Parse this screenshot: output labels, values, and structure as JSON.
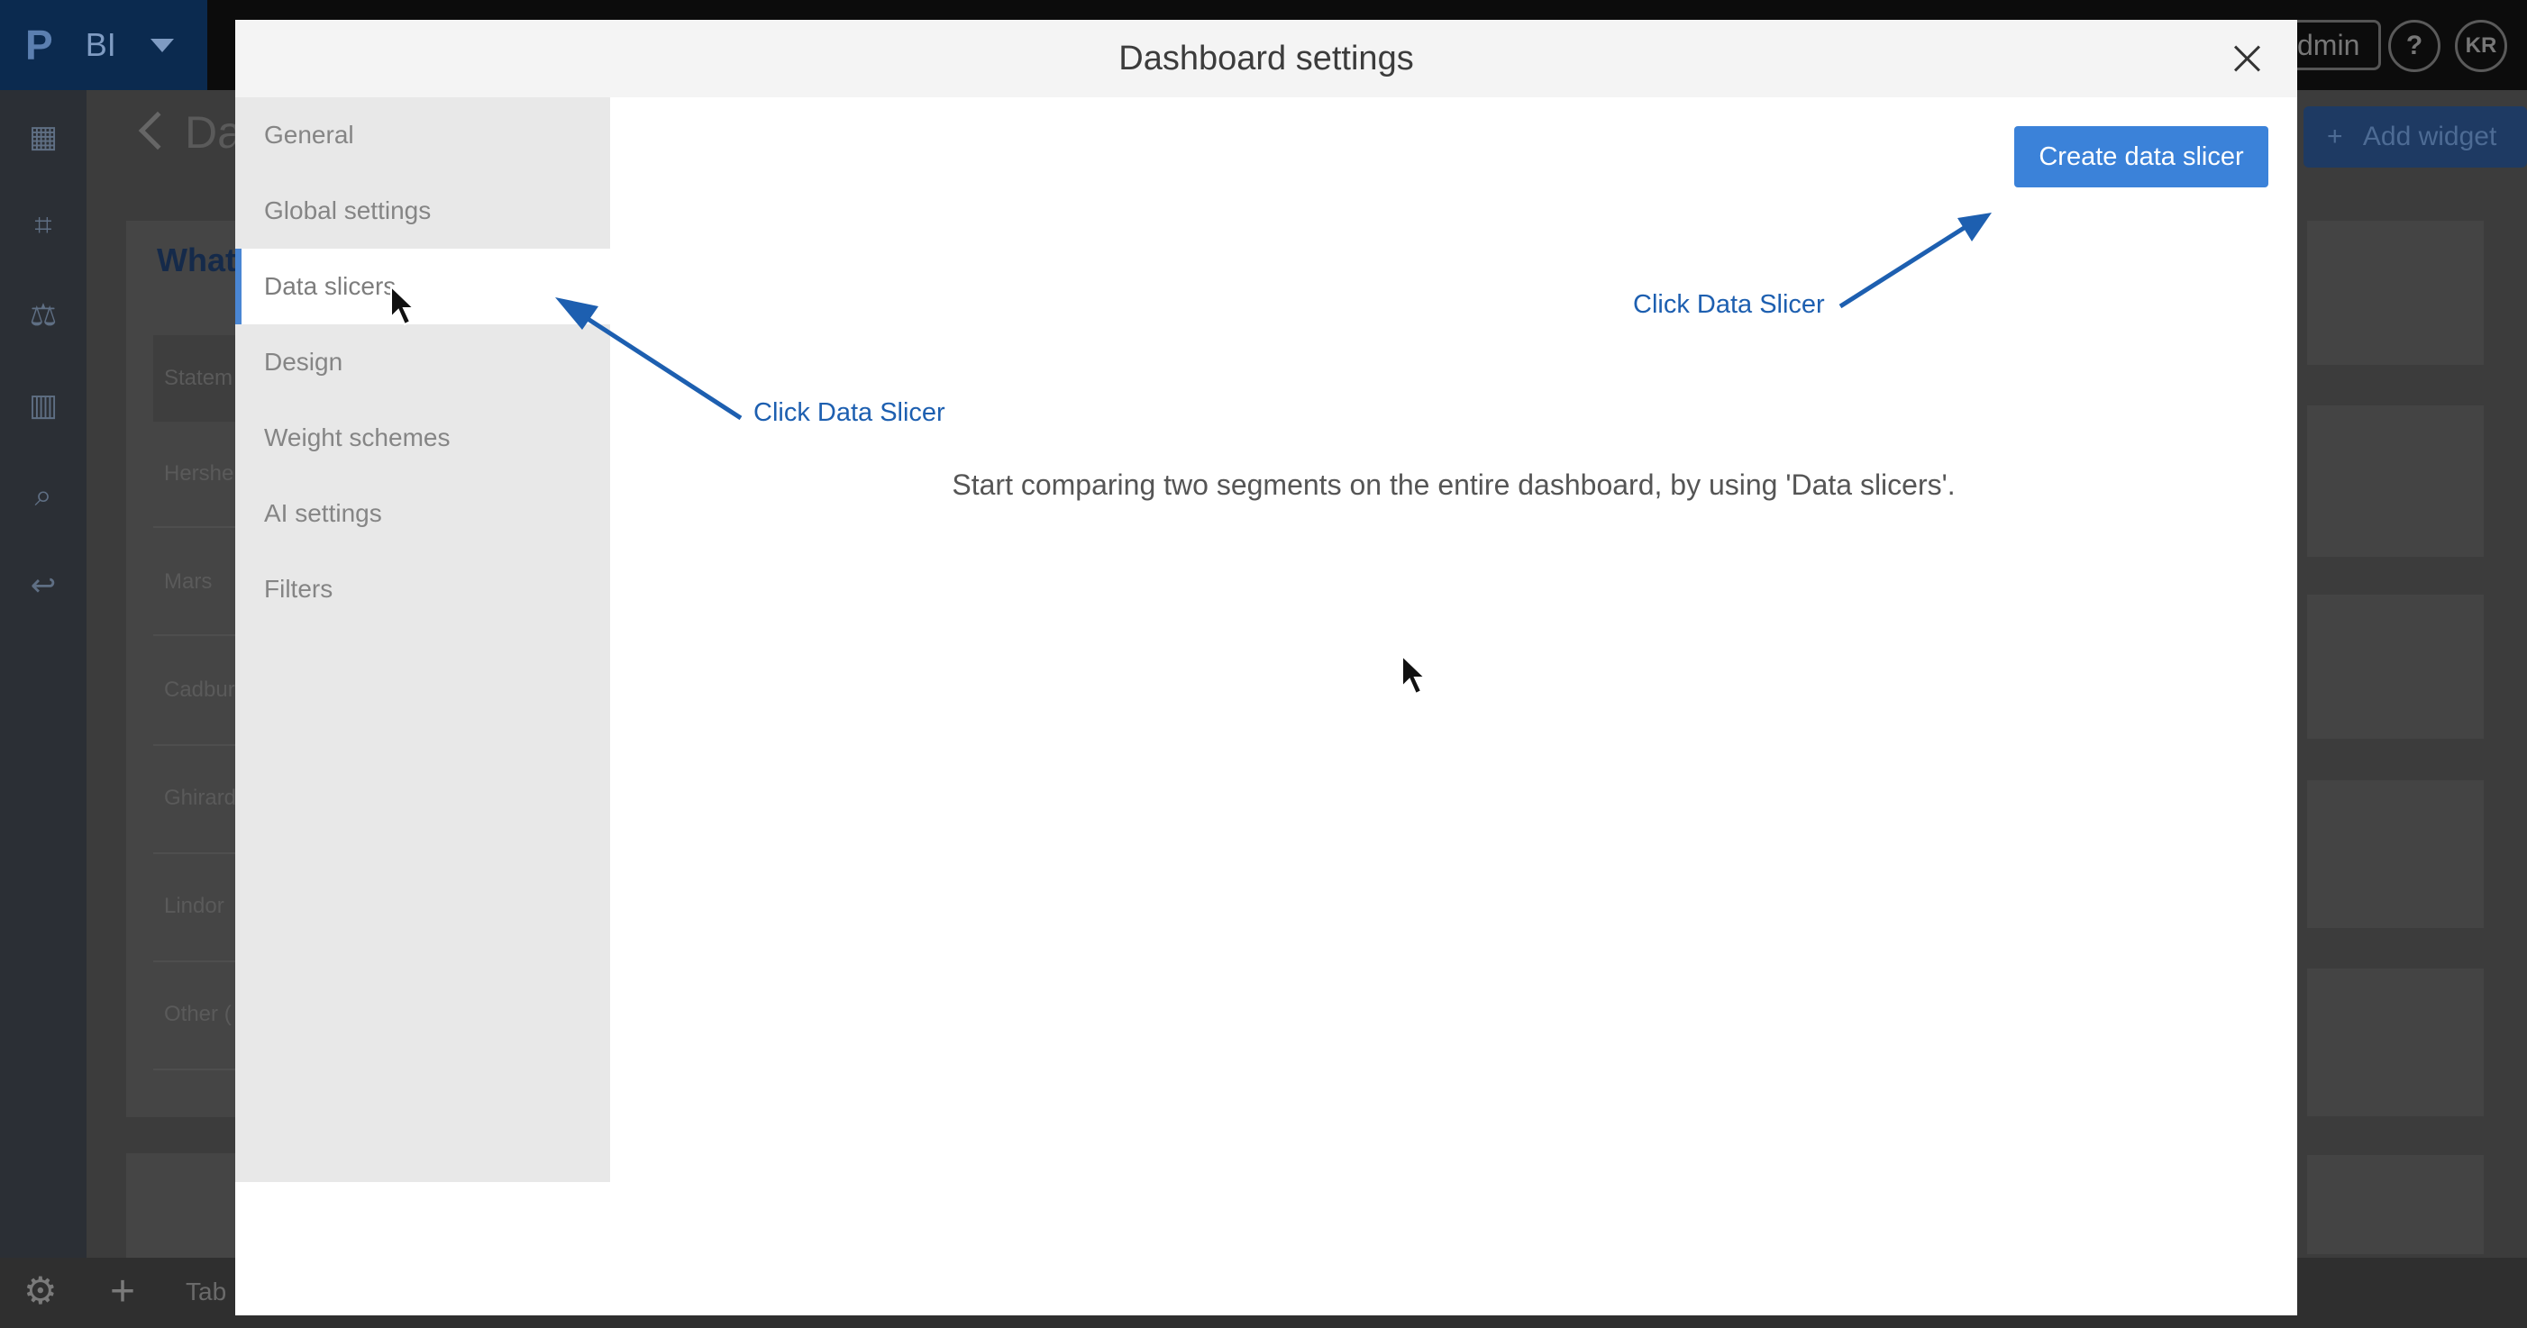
{
  "app": {
    "brand_logo": "P",
    "brand_label": "BI",
    "admin_label": "dmin",
    "help_label": "?",
    "avatar_initials": "KR",
    "dashboard_title": "Da",
    "add_widget_label": "Add widget",
    "widget_title": "What",
    "table_header": "Statem",
    "table_rows": [
      "Hershe",
      "Mars",
      "Cadbur",
      "Ghirard",
      "Lindor",
      "Other ("
    ],
    "tab_label": "Tab"
  },
  "modal": {
    "title": "Dashboard settings",
    "nav_items": [
      {
        "label": "General"
      },
      {
        "label": "Global settings"
      },
      {
        "label": "Data slicers"
      },
      {
        "label": "Design"
      },
      {
        "label": "Weight schemes"
      },
      {
        "label": "AI settings"
      },
      {
        "label": "Filters"
      }
    ],
    "active_item": "Data slicers",
    "create_button_label": "Create data slicer",
    "empty_message": "Start comparing two segments on the entire dashboard, by using 'Data slicers'."
  },
  "annotations": {
    "left_callout": "Click Data Slicer",
    "right_callout": "Click Data Slicer"
  },
  "colors": {
    "accent": "#3b82d9",
    "annotation": "#1d5fb0",
    "active_indicator": "#4a86d4"
  }
}
